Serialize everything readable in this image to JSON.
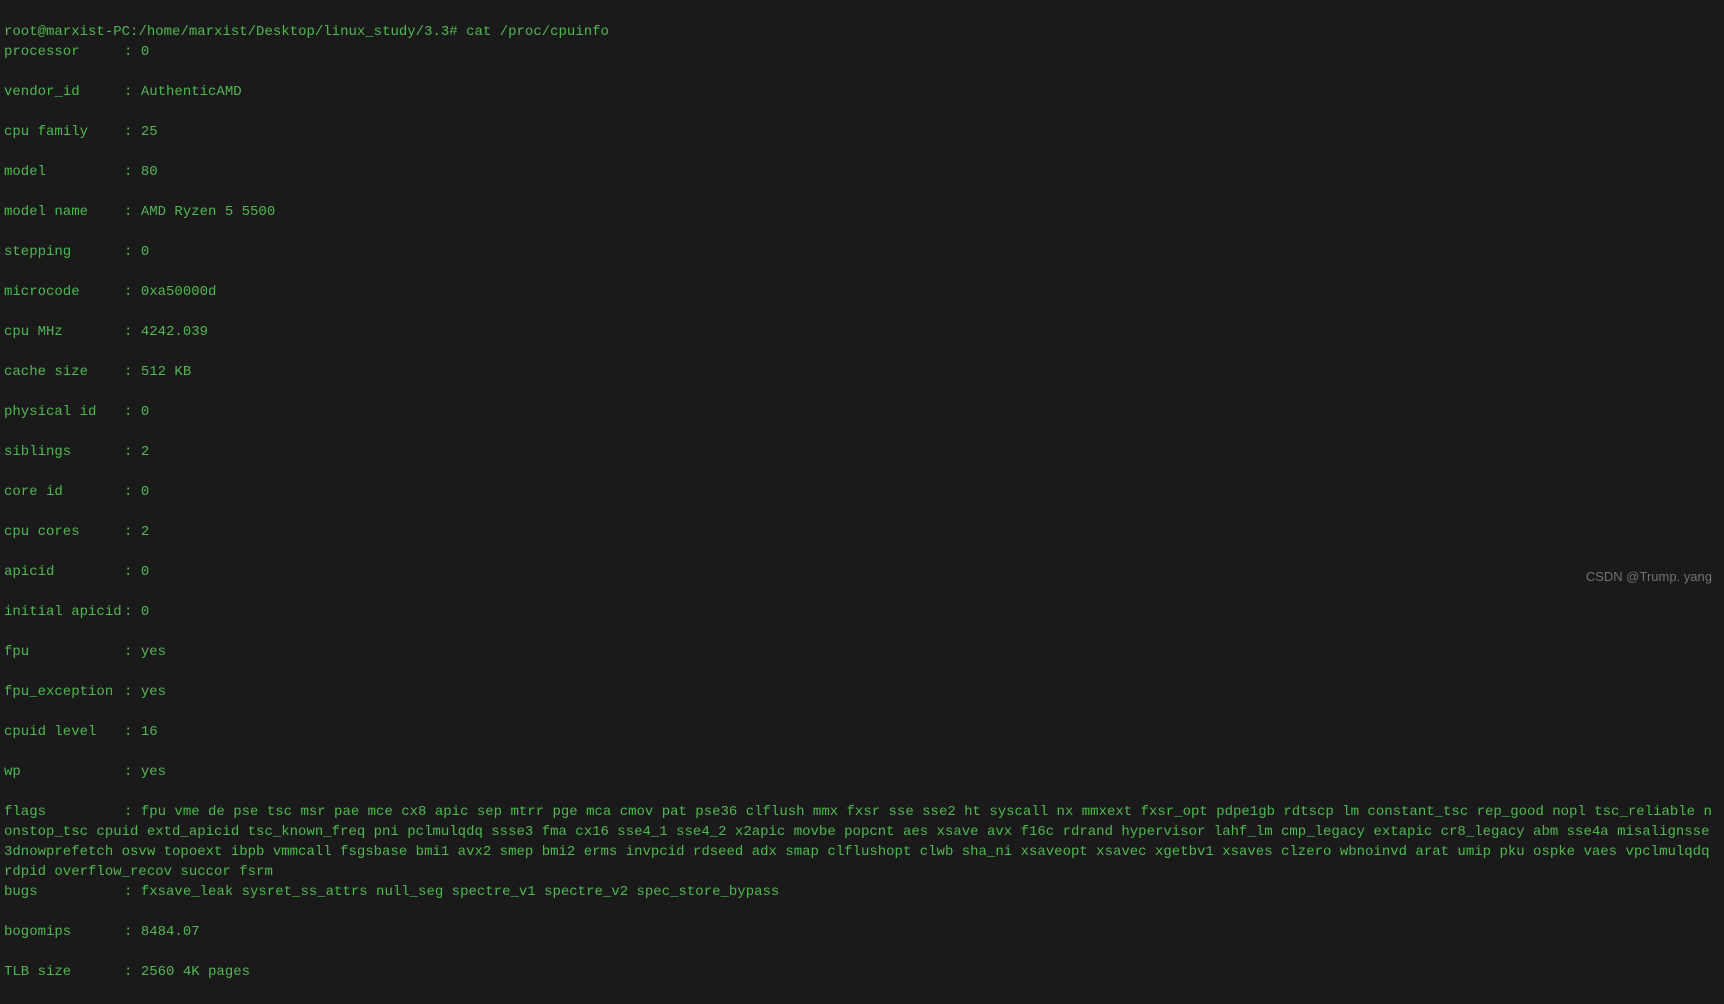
{
  "prompt": {
    "user_host": "root@marxist-PC",
    "path": "/home/marxist/Desktop/linux_study/3.3",
    "symbol": "#",
    "command": "cat /proc/cpuinfo"
  },
  "cpuinfo": {
    "processor": "0",
    "vendor_id": "AuthenticAMD",
    "cpu_family": "25",
    "model": "80",
    "model_name": "AMD Ryzen 5 5500",
    "stepping": "0",
    "microcode": "0xa50000d",
    "cpu_mhz": "4242.039",
    "cache_size": "512 KB",
    "physical_id": "0",
    "siblings": "2",
    "core_id": "0",
    "cpu_cores": "2",
    "apicid": "0",
    "initial_apicid": "0",
    "fpu": "yes",
    "fpu_exception": "yes",
    "cpuid_level": "16",
    "wp": "yes",
    "flags": "fpu vme de pse tsc msr pae mce cx8 apic sep mtrr pge mca cmov pat pse36 clflush mmx fxsr sse sse2 ht syscall nx mmxext fxsr_opt pdpe1gb rdtscp lm constant_tsc rep_good nopl tsc_reliable nonstop_tsc cpuid extd_apicid tsc_known_freq pni pclmulqdq ssse3 fma cx16 sse4_1 sse4_2 x2apic movbe popcnt aes xsave avx f16c rdrand hypervisor lahf_lm cmp_legacy extapic cr8_legacy abm sse4a misalignsse 3dnowprefetch osvw topoext ibpb vmmcall fsgsbase bmi1 avx2 smep bmi2 erms invpcid rdseed adx smap clflushopt clwb sha_ni xsaveopt xsavec xgetbv1 xsaves clzero wbnoinvd arat umip pku ospke vaes vpclmulqdq rdpid overflow_recov succor fsrm",
    "bugs": "fxsave_leak sysret_ss_attrs null_seg spectre_v1 spectre_v2 spec_store_bypass",
    "bogomips": "8484.07",
    "tlb_size": "2560 4K pages"
  },
  "labels": {
    "processor": "processor",
    "vendor_id": "vendor_id",
    "cpu_family": "cpu family",
    "model": "model",
    "model_name": "model name",
    "stepping": "stepping",
    "microcode": "microcode",
    "cpu_mhz": "cpu MHz",
    "cache_size": "cache size",
    "physical_id": "physical id",
    "siblings": "siblings",
    "core_id": "core id",
    "cpu_cores": "cpu cores",
    "apicid": "apicid",
    "initial_apicid": "initial apicid",
    "fpu": "fpu",
    "fpu_exception": "fpu_exception",
    "cpuid_level": "cpuid level",
    "wp": "wp",
    "flags": "flags",
    "bugs": "bugs",
    "bogomips": "bogomips",
    "tlb_size": "TLB size"
  },
  "watermark": "CSDN @Trump. yang"
}
